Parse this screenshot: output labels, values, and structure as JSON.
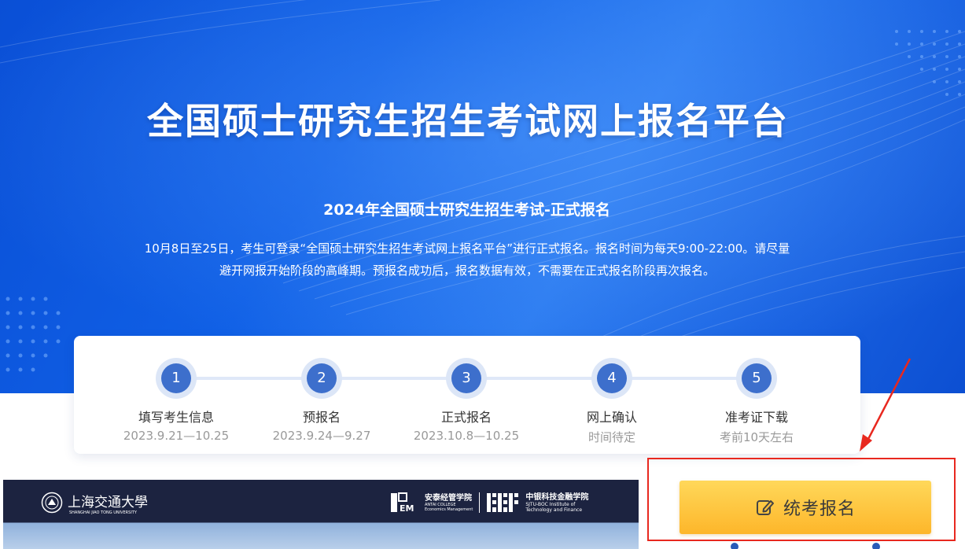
{
  "header": {
    "title": "全国硕士研究生招生考试网上报名平台"
  },
  "announcement": {
    "subtitle": "2024年全国硕士研究生招生考试-正式报名",
    "line1": "10月8日至25日，考生可登录“全国硕士研究生招生考试网上报名平台”进行正式报名。报名时间为每天9:00-22:00。请尽量",
    "line2": "避开网报开始阶段的高峰期。预报名成功后，报名数据有效，不需要在正式报名阶段再次报名。"
  },
  "steps": [
    {
      "number": "1",
      "title": "填写考生信息",
      "date": "2023.9.21—10.25"
    },
    {
      "number": "2",
      "title": "预报名",
      "date": "2023.9.24—9.27"
    },
    {
      "number": "3",
      "title": "正式报名",
      "date": "2023.10.8—10.25"
    },
    {
      "number": "4",
      "title": "网上确认",
      "date": "时间待定"
    },
    {
      "number": "5",
      "title": "准考证下载",
      "date": "考前10天左右"
    }
  ],
  "banner": {
    "sjtu_name": "上海交通大學",
    "sjtu_english": "SHANGHAI JIAO TONG UNIVERSITY",
    "antai_name": "安泰经管学院",
    "antai_english_1": "ANTAI COLLEGE",
    "antai_english_2": "Economics Management",
    "sjtuboc_name": "中银科技金融学院",
    "sjtuboc_english_1": "SJTU-BOC Institute of",
    "sjtuboc_english_2": "Technology and Finance"
  },
  "actions": {
    "register_label": "统考报名",
    "register_icon": "edit-icon"
  },
  "colors": {
    "hero_blue": "#1060e6",
    "step_circle": "#3d6fcc",
    "button_yellow": "#fdb62a",
    "highlight_red": "#e8281f"
  }
}
